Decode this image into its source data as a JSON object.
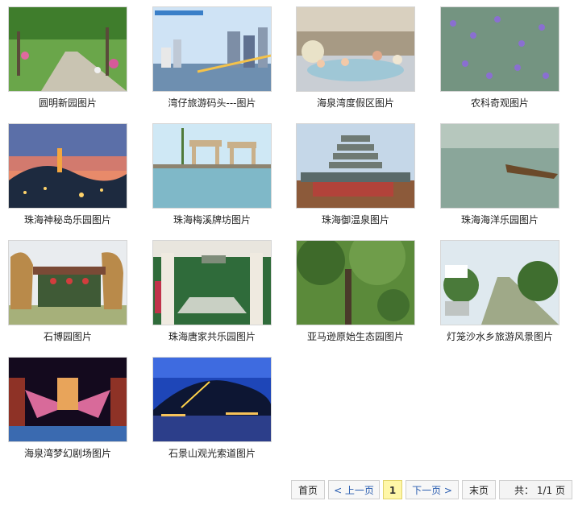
{
  "gallery": {
    "items": [
      {
        "caption": "圆明新园图片",
        "scene": "park-path"
      },
      {
        "caption": "湾仔旅游码头---图片",
        "scene": "harbor-city"
      },
      {
        "caption": "海泉湾度假区图片",
        "scene": "hot-spring"
      },
      {
        "caption": "农科奇观图片",
        "scene": "lavender"
      },
      {
        "caption": "珠海神秘岛乐园图片",
        "scene": "night-island"
      },
      {
        "caption": "珠海梅溪牌坊图片",
        "scene": "archway"
      },
      {
        "caption": "珠海御温泉图片",
        "scene": "pagoda"
      },
      {
        "caption": "珠海海洋乐园图片",
        "scene": "sea"
      },
      {
        "caption": "石博园图片",
        "scene": "stone-garden"
      },
      {
        "caption": "珠海唐家共乐园图片",
        "scene": "gate"
      },
      {
        "caption": "亚马逊原始生态园图片",
        "scene": "forest"
      },
      {
        "caption": "灯笼沙水乡旅游风景图片",
        "scene": "canal"
      },
      {
        "caption": "海泉湾梦幻剧场图片",
        "scene": "theater"
      },
      {
        "caption": "石景山观光索道图片",
        "scene": "night-hill"
      }
    ]
  },
  "pagination": {
    "first": "首页",
    "prev": "< 上一页",
    "current": "1",
    "next": "下一页 >",
    "last": "末页",
    "total": "共： 1/1 页"
  }
}
